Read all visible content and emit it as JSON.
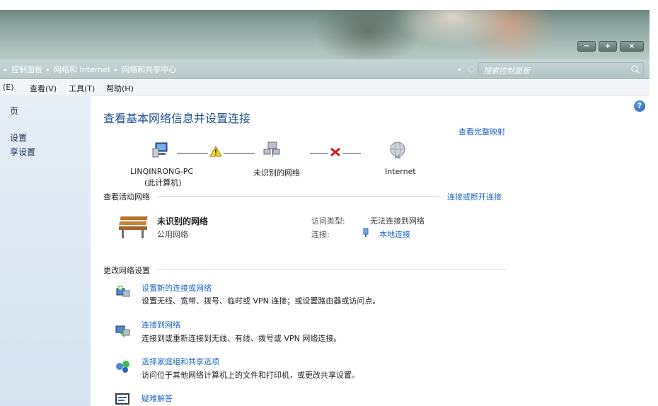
{
  "window": {
    "buttons": {
      "minimize": "−",
      "maximize": "+",
      "close": "×"
    }
  },
  "address": {
    "crumbs": [
      "控制面板",
      "网络和 Internet",
      "网络和共享中心"
    ],
    "nav": {
      "back": "◂",
      "refresh": "○"
    },
    "search_placeholder": "搜索控制面板"
  },
  "menu": [
    "(E)",
    "查看(V)",
    "工具(T)",
    "帮助(H)"
  ],
  "sidebar": {
    "items": [
      "页",
      "设置",
      "享设置"
    ]
  },
  "main": {
    "title": "查看基本网络信息并设置连接",
    "view_full_map": "查看完整映射",
    "map": {
      "computer_name": "LINQINRONG-PC",
      "computer_sub": "(此计算机)",
      "network": "未识别的网络",
      "internet": "Internet"
    },
    "active": {
      "header": "查看活动网络",
      "connect_link": "连接或断开连接",
      "network_name": "未识别的网络",
      "network_type": "公用网络",
      "access_label": "访问类型:",
      "access_value": "无法连接到网络",
      "conn_label": "连接:",
      "conn_value": "本地连接"
    },
    "change": {
      "header": "更改网络设置",
      "tasks": [
        {
          "title": "设置新的连接或网络",
          "desc": "设置无线、宽带、拨号、临时或 VPN 连接；或设置路由器或访问点。"
        },
        {
          "title": "连接到网络",
          "desc": "连接到或重新连接到无线、有线、拨号或 VPN 网络连接。"
        },
        {
          "title": "选择家庭组和共享选项",
          "desc": "访问位于其他网络计算机上的文件和打印机，或更改共享设置。"
        },
        {
          "title": "疑难解答",
          "desc": ""
        }
      ]
    },
    "help": "?"
  },
  "colors": {
    "link": "#1f65c4",
    "title": "#1e4f91",
    "sidebar": "#dbe7f2"
  }
}
